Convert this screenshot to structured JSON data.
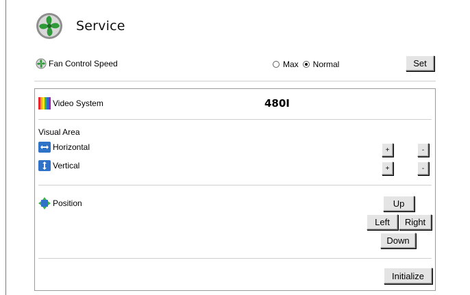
{
  "header": {
    "title": "Service"
  },
  "fan": {
    "label": "Fan Control Speed",
    "options": [
      {
        "label": "Max",
        "checked": false
      },
      {
        "label": "Normal",
        "checked": true
      }
    ],
    "set_label": "Set"
  },
  "video": {
    "label": "Video System",
    "value": "480I"
  },
  "visual_area": {
    "label": "Visual Area",
    "horizontal": {
      "label": "Horizontal",
      "plus": "+",
      "minus": "-"
    },
    "vertical": {
      "label": "Vertical",
      "plus": "+",
      "minus": "-"
    }
  },
  "position": {
    "label": "Position",
    "up": "Up",
    "left": "Left",
    "right": "Right",
    "down": "Down"
  },
  "initialize_label": "Initialize",
  "colors": {
    "fan_green": "#2e9a3a",
    "arrow_blue": "#2f73c9",
    "button_bg": "#e4e4e4"
  }
}
